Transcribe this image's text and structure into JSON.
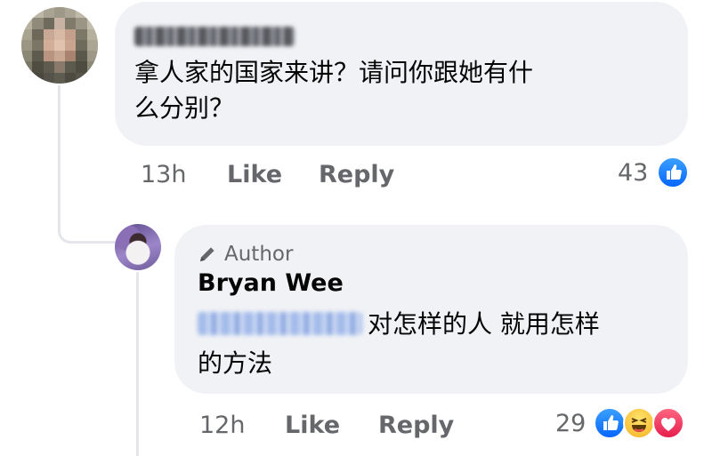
{
  "comment": {
    "text_line1": "拿人家的国家来讲？请问你跟她有什",
    "text_line2": "么分别？",
    "time": "13h",
    "like_label": "Like",
    "reply_label": "Reply",
    "reaction_count": "43",
    "reactions": [
      "like-icon"
    ]
  },
  "reply": {
    "badge": "Author",
    "author_name": "Bryan Wee",
    "text_line1_after_mention": "对怎样的人 就用怎样",
    "text_line2": "的方法",
    "time": "12h",
    "like_label": "Like",
    "reply_label": "Reply",
    "reaction_count": "29",
    "reactions": [
      "like-icon",
      "haha-icon",
      "love-icon"
    ]
  },
  "colors": {
    "bubble": "#f0f2f5",
    "meta_text": "#65676b",
    "like_blue": "#0866ff",
    "love_red": "#e61e4d",
    "haha_yellow": "#f7b125"
  }
}
